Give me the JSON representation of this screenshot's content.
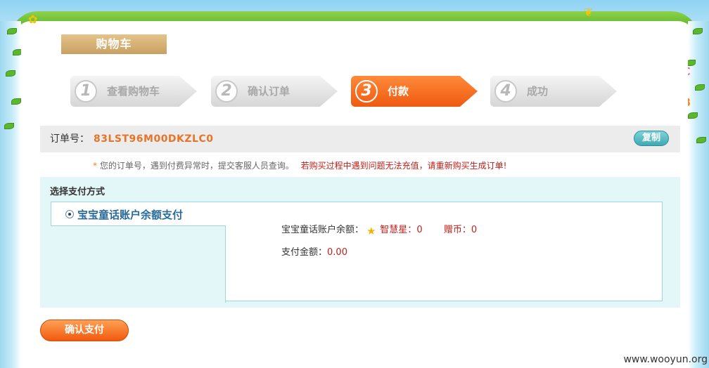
{
  "header": {
    "cart_title": "购物车"
  },
  "steps": [
    {
      "num": "1",
      "label": "查看购物车",
      "active": false
    },
    {
      "num": "2",
      "label": "确认订单",
      "active": false
    },
    {
      "num": "3",
      "label": "付款",
      "active": true
    },
    {
      "num": "4",
      "label": "成功",
      "active": false
    }
  ],
  "order": {
    "label": "订单号：",
    "number": "83LST96M00DKZLC0",
    "copy_label": "复制"
  },
  "notice": {
    "star": "*",
    "text": "您的订单号，遇到付费异常时，提交客服人员查询。",
    "warning": "若购买过程中遇到问题无法充值，请重新购买生成订单!"
  },
  "payment": {
    "section_title": "选择支付方式",
    "option_label": "宝宝童话账户余额支付",
    "balance_label": "宝宝童话账户余额：",
    "wisdom_star_label": "智慧星：",
    "wisdom_star_value": "0",
    "coin_label": "赠币：",
    "coin_value": "0",
    "amount_label": "支付金额：",
    "amount_value": "0.00"
  },
  "actions": {
    "confirm_label": "确认支付"
  },
  "watermark": "www.wooyun.org",
  "colors": {
    "accent_orange": "#f05a0e",
    "teal": "#3ea9b3",
    "red_text": "#c0201a"
  }
}
